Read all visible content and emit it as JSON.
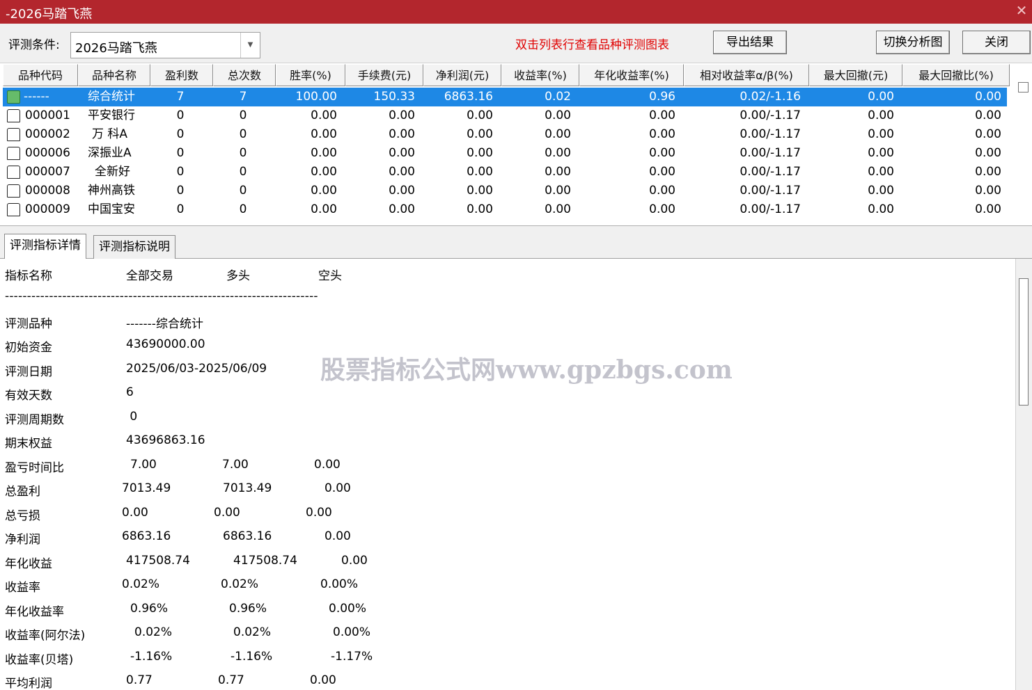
{
  "window": {
    "title": "-2026马踏飞燕",
    "close_glyph": "✕"
  },
  "toolbar": {
    "condition_label": "评测条件:",
    "condition_value": "2026马踏飞燕",
    "hint": "双击列表行查看品种评测图表",
    "export_button": "导出结果",
    "switch_chart_button": "切换分析图",
    "close_button": "关闭"
  },
  "grid": {
    "columns": [
      "品种代码",
      "品种名称",
      "盈利数",
      "总次数",
      "胜率(%)",
      "手续费(元)",
      "净利润(元)",
      "收益率(%)",
      "年化收益率(%)",
      "相对收益率α/β(%)",
      "最大回撤(元)",
      "最大回撤比(%)"
    ],
    "rows": [
      {
        "code": "------",
        "name": "综合统计",
        "wins": "7",
        "total": "7",
        "win_rate": "100.00",
        "fee": "150.33",
        "net_profit": "6863.16",
        "return": "0.02",
        "annual_return": "0.96",
        "alpha_beta": "0.02/-1.16",
        "max_dd": "0.00",
        "max_dd_ratio": "0.00",
        "selected": true
      },
      {
        "code": "000001",
        "name": "平安银行",
        "wins": "0",
        "total": "0",
        "win_rate": "0.00",
        "fee": "0.00",
        "net_profit": "0.00",
        "return": "0.00",
        "annual_return": "0.00",
        "alpha_beta": "0.00/-1.17",
        "max_dd": "0.00",
        "max_dd_ratio": "0.00"
      },
      {
        "code": "000002",
        "name": "万 科A",
        "wins": "0",
        "total": "0",
        "win_rate": "0.00",
        "fee": "0.00",
        "net_profit": "0.00",
        "return": "0.00",
        "annual_return": "0.00",
        "alpha_beta": "0.00/-1.17",
        "max_dd": "0.00",
        "max_dd_ratio": "0.00"
      },
      {
        "code": "000006",
        "name": "深振业A",
        "wins": "0",
        "total": "0",
        "win_rate": "0.00",
        "fee": "0.00",
        "net_profit": "0.00",
        "return": "0.00",
        "annual_return": "0.00",
        "alpha_beta": "0.00/-1.17",
        "max_dd": "0.00",
        "max_dd_ratio": "0.00"
      },
      {
        "code": "000007",
        "name": "全新好",
        "wins": "0",
        "total": "0",
        "win_rate": "0.00",
        "fee": "0.00",
        "net_profit": "0.00",
        "return": "0.00",
        "annual_return": "0.00",
        "alpha_beta": "0.00/-1.17",
        "max_dd": "0.00",
        "max_dd_ratio": "0.00"
      },
      {
        "code": "000008",
        "name": "神州高铁",
        "wins": "0",
        "total": "0",
        "win_rate": "0.00",
        "fee": "0.00",
        "net_profit": "0.00",
        "return": "0.00",
        "annual_return": "0.00",
        "alpha_beta": "0.00/-1.17",
        "max_dd": "0.00",
        "max_dd_ratio": "0.00"
      },
      {
        "code": "000009",
        "name": "中国宝安",
        "wins": "0",
        "total": "0",
        "win_rate": "0.00",
        "fee": "0.00",
        "net_profit": "0.00",
        "return": "0.00",
        "annual_return": "0.00",
        "alpha_beta": "0.00/-1.17",
        "max_dd": "0.00",
        "max_dd_ratio": "0.00"
      }
    ]
  },
  "tabs": [
    {
      "label": "评测指标详情",
      "active": true
    },
    {
      "label": "评测指标说明",
      "active": false
    }
  ],
  "detail": {
    "headers": {
      "name": "指标名称",
      "all": "全部交易",
      "long": "多头",
      "short": "空头"
    },
    "separator": "-----------------------------------------------------------------------",
    "rows": [
      {
        "label": "评测品种",
        "all": "-------综合统计",
        "long": "",
        "short": ""
      },
      {
        "label": "初始资金",
        "all": "43690000.00",
        "long": "",
        "short": ""
      },
      {
        "label": "评测日期",
        "all": "2025/06/03-2025/06/09",
        "long": "",
        "short": ""
      },
      {
        "label": "有效天数",
        "all": "6",
        "long": "",
        "short": ""
      },
      {
        "label": "评测周期数",
        "all": " 0",
        "long": "",
        "short": ""
      },
      {
        "label": "期末权益",
        "all": "43696863.16",
        "long": "",
        "short": ""
      },
      {
        "label": "盈亏时间比",
        "all": "7.00",
        "long": "7.00",
        "short": "0.00"
      },
      {
        "label": "总盈利",
        "all": "7013.49",
        "long": "7013.49",
        "short": "0.00"
      },
      {
        "label": "总亏损",
        "all": "0.00",
        "long": "0.00",
        "short": "0.00"
      },
      {
        "label": "净利润",
        "all": "6863.16",
        "long": "6863.16",
        "short": "0.00"
      },
      {
        "label": "年化收益",
        "all": "417508.74",
        "long": "417508.74",
        "short": "0.00"
      },
      {
        "label": "收益率",
        "all": "0.02%",
        "long": "0.02%",
        "short": "0.00%"
      },
      {
        "label": "年化收益率",
        "all": "0.96%",
        "long": "0.96%",
        "short": "0.00%"
      },
      {
        "label": "收益率(阿尔法)",
        "all": "0.02%",
        "long": "0.02%",
        "short": "0.00%"
      },
      {
        "label": "收益率(贝塔)",
        "all": "-1.16%",
        "long": "-1.16%",
        "short": "-1.17%"
      },
      {
        "label": "平均利润",
        "all": "0.77",
        "long": "0.77",
        "short": "0.00"
      }
    ]
  },
  "watermark": "股票指标公式网www.gpzbgs.com"
}
